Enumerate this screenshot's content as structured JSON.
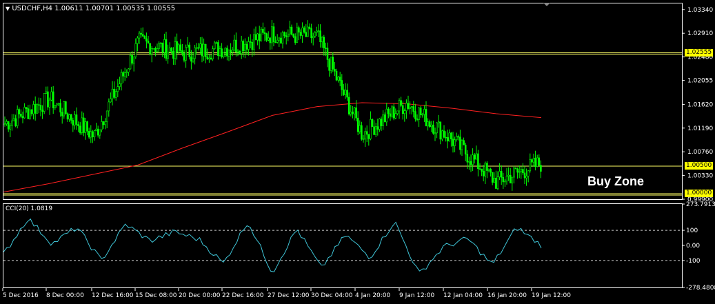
{
  "header": {
    "menu_arrow_icon": "triangle-down-icon",
    "symbol": "USDCHF,H4",
    "ohlc": "1.00611 1.00701 1.00535 1.00555"
  },
  "annotation": {
    "buy_zone": "Buy Zone"
  },
  "price_axis": {
    "ticks": [
      "1.03340",
      "1.02910",
      "1.02480",
      "1.02055",
      "1.01620",
      "1.01190",
      "1.00760",
      "1.00330",
      "0.99900"
    ],
    "tick_values": [
      1.0334,
      1.0291,
      1.0248,
      1.02055,
      1.0162,
      1.0119,
      1.0076,
      1.0033,
      0.999
    ],
    "levels": [
      {
        "label": "1.02555",
        "value": 1.02555,
        "color": "#ffff66"
      },
      {
        "label": "1.00500",
        "value": 1.005,
        "color": "#ffff66"
      },
      {
        "label": "1.00000",
        "value": 1.0,
        "color": "#ffff66"
      }
    ]
  },
  "indicator": {
    "title": "CCI(20) 1.0819",
    "ticks": [
      "273.7913",
      "100",
      "0.00",
      "-100",
      "-278.4808"
    ],
    "tick_values": [
      273.7913,
      100,
      0,
      -100,
      -278.4808
    ],
    "line_color": "#3fc6d8"
  },
  "time_axis": {
    "labels": [
      "5 Dec 2016",
      "8 Dec 00:00",
      "12 Dec 16:00",
      "15 Dec 08:00",
      "20 Dec 00:00",
      "22 Dec 16:00",
      "27 Dec 12:00",
      "30 Dec 04:00",
      "4 Jan 20:00",
      "9 Jan 12:00",
      "12 Jan 04:00",
      "16 Jan 20:00",
      "19 Jan 12:00"
    ]
  },
  "colors": {
    "candles": "#00ff00",
    "moving_average": "#ff2020",
    "level_line": "#ffff66",
    "axis": "#ffffff",
    "background": "#000000"
  },
  "chart_data": {
    "type": "candlestick",
    "symbol": "USDCHF",
    "timeframe": "H4",
    "ylim": [
      0.999,
      1.0345
    ],
    "x": [
      "5 Dec 2016",
      "8 Dec 00:00",
      "12 Dec 16:00",
      "15 Dec 08:00",
      "20 Dec 00:00",
      "22 Dec 16:00",
      "27 Dec 12:00",
      "30 Dec 04:00",
      "4 Jan 20:00",
      "9 Jan 12:00",
      "12 Jan 04:00",
      "16 Jan 20:00",
      "19 Jan 12:00"
    ],
    "close_approx": [
      1.0127,
      1.0172,
      1.0104,
      1.0275,
      1.0255,
      1.0265,
      1.029,
      1.0285,
      1.0108,
      1.0165,
      1.0099,
      1.0022,
      1.0055
    ],
    "moving_average": [
      1.0003,
      1.0018,
      1.0035,
      1.0052,
      1.0083,
      1.0112,
      1.0142,
      1.0158,
      1.0165,
      1.0163,
      1.0155,
      1.0145,
      1.0138
    ],
    "horizontal_levels": [
      1.02555,
      1.005,
      1.0
    ],
    "cci": {
      "name": "CCI(20)",
      "last": 1.0819,
      "ylim": [
        -278.4808,
        273.7913
      ],
      "values": [
        -60,
        180,
        10,
        120,
        -100,
        140,
        30,
        90,
        40,
        -120,
        160,
        -180,
        110,
        -150,
        70,
        -80,
        160,
        -190,
        -10,
        45,
        -130,
        120,
        1.08
      ]
    }
  }
}
